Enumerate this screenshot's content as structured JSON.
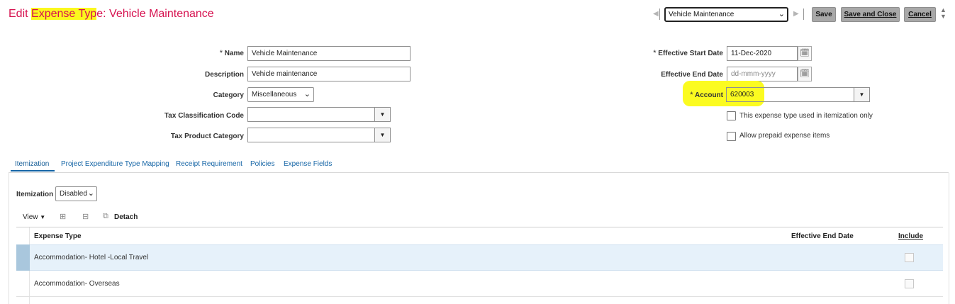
{
  "header": {
    "title_prefix": "Edit ",
    "title_highlight": "Expense Typ",
    "title_suffix": "e: Vehicle Maintenance",
    "nav_value": "Vehicle Maintenance",
    "save_label": "Save",
    "save_close_label": "Save and Close",
    "cancel_label": "Cancel"
  },
  "form": {
    "name_label": "Name",
    "name_value": "Vehicle Maintenance",
    "description_label": "Description",
    "description_value": "Vehicle maintenance",
    "category_label": "Category",
    "category_value": "Miscellaneous",
    "tax_class_label": "Tax Classification Code",
    "tax_class_value": "",
    "tax_product_label": "Tax Product Category",
    "tax_product_value": "",
    "start_date_label": "Effective Start Date",
    "start_date_value": "11-Dec-2020",
    "end_date_label": "Effective End Date",
    "end_date_placeholder": "dd-mmm-yyyy",
    "account_label": "Account",
    "account_value": "620003",
    "itemization_only_label": "This expense type used in itemization only",
    "prepaid_label": "Allow prepaid expense items",
    "required_mark": "*"
  },
  "tabs": [
    {
      "label": "Itemization",
      "active": true
    },
    {
      "label": "Project Expenditure Type Mapping",
      "active": false
    },
    {
      "label": "Receipt Requirement",
      "active": false
    },
    {
      "label": "Policies",
      "active": false
    },
    {
      "label": "Expense Fields",
      "active": false
    }
  ],
  "itemization": {
    "label": "Itemization",
    "value": "Disabled",
    "view_label": "View",
    "detach_label": "Detach",
    "columns": {
      "expense_type": "Expense Type",
      "end_date": "Effective End Date",
      "include": "Include"
    },
    "rows": [
      {
        "expense_type": "Accommodation- Hotel -Local Travel",
        "end_date": "",
        "include": false
      },
      {
        "expense_type": "Accommodation- Overseas",
        "end_date": "",
        "include": false
      }
    ]
  },
  "colors": {
    "title": "#d6114f",
    "highlight": "#fbf81d",
    "link": "#1565a6",
    "selected_row": "#e6f1fa"
  }
}
